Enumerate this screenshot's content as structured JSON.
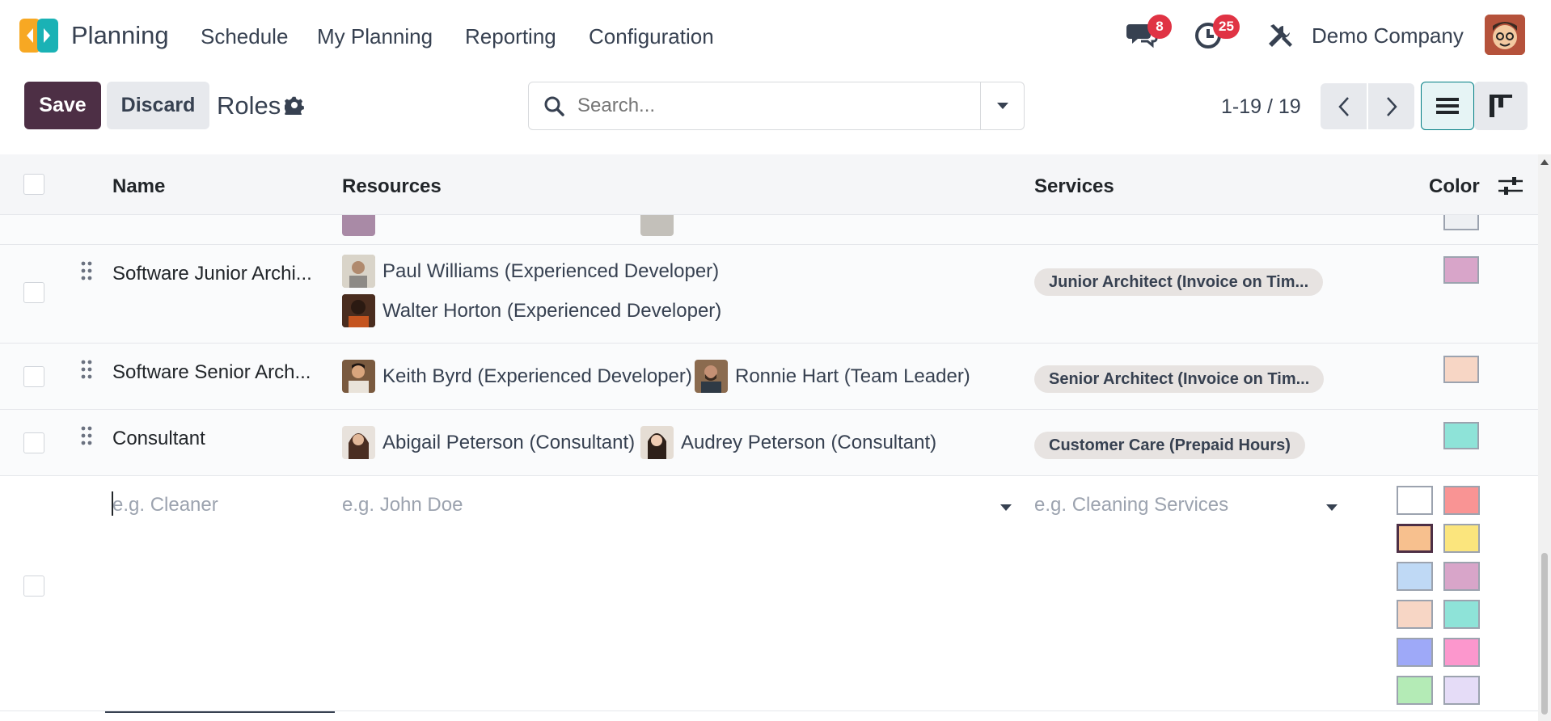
{
  "nav": {
    "app_name": "Planning",
    "menus": [
      "Schedule",
      "My Planning",
      "Reporting",
      "Configuration"
    ],
    "messages_count": "8",
    "activities_count": "25",
    "company": "Demo Company"
  },
  "control": {
    "save": "Save",
    "discard": "Discard",
    "breadcrumb": "Roles",
    "search_placeholder": "Search...",
    "pager": "1-19 / 19"
  },
  "table": {
    "headers": {
      "name": "Name",
      "resources": "Resources",
      "services": "Services",
      "color": "Color"
    },
    "rows": [
      {
        "name": "Software Junior Archi...",
        "resources": [
          "Paul Williams (Experienced Developer)",
          "Walter Horton (Experienced Developer)"
        ],
        "service": "Junior Architect (Invoice on Tim...",
        "color": "#d8a5c9"
      },
      {
        "name": "Software Senior Arch...",
        "resources": [
          "Keith Byrd (Experienced Developer)",
          "Ronnie Hart (Team Leader)"
        ],
        "service": "Senior Architect (Invoice on Tim...",
        "color": "#f7d6c5"
      },
      {
        "name": "Consultant",
        "resources": [
          "Abigail Peterson (Consultant)",
          "Audrey Peterson (Consultant)"
        ],
        "service": "Customer Care (Prepaid Hours)",
        "color": "#8ee3d8"
      }
    ],
    "new_row": {
      "name_placeholder": "e.g. Cleaner",
      "resources_placeholder": "e.g. John Doe",
      "services_placeholder": "e.g. Cleaning Services",
      "palette": [
        "#ffffff",
        "#f99494",
        "#f7c08e",
        "#fbe57d",
        "#bfd9f5",
        "#d8a5c9",
        "#f7d6c5",
        "#8ee3d8",
        "#9ea9f8",
        "#fc97cd",
        "#b4ebb6",
        "#e5dcf7"
      ],
      "selected_color": "#f7c08e"
    }
  },
  "colors": {
    "brand": "#4d2f45",
    "accent": "#017e84",
    "badge": "#e03344"
  }
}
